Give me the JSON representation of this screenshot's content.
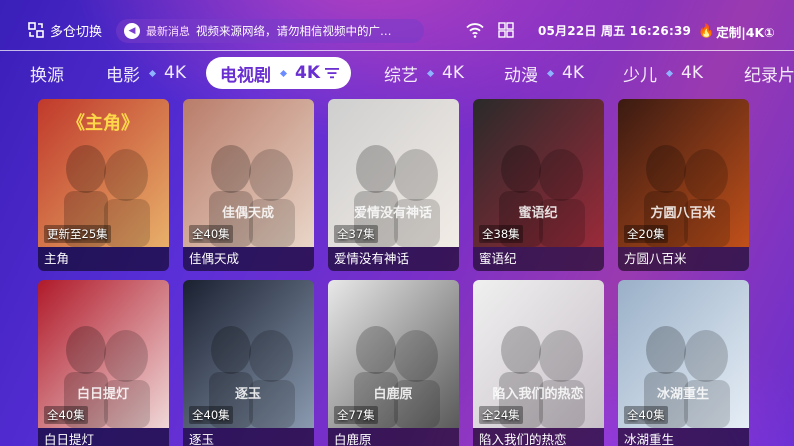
{
  "header": {
    "warehouse_switch": "多仓切换",
    "news_tag": "最新消息",
    "news_text": "视频来源网络，请勿相信视频中的广…",
    "datetime": "05月22日 周五 16:26:39",
    "custom_label": "定制|4K①"
  },
  "tabs": [
    {
      "label": "换源"
    },
    {
      "label": "电影",
      "badge": "4K"
    },
    {
      "label": "电视剧",
      "badge": "4K",
      "active": true
    },
    {
      "label": "综艺",
      "badge": "4K"
    },
    {
      "label": "动漫",
      "badge": "4K"
    },
    {
      "label": "少儿",
      "badge": "4K"
    },
    {
      "label": "纪录片"
    }
  ],
  "cards": [
    {
      "title": "主角",
      "episodes": "更新至25集",
      "poster_text": "《主角》",
      "tone": [
        "#c0392b",
        "#e8b06a"
      ]
    },
    {
      "title": "佳偶天成",
      "episodes": "全40集",
      "poster_text": "佳偶天成",
      "tone": [
        "#b97c6a",
        "#e9d6c8"
      ]
    },
    {
      "title": "爱情没有神话",
      "episodes": "全37集",
      "poster_text": "爱情没有神话",
      "tone": [
        "#cfcfcf",
        "#f2ece6"
      ]
    },
    {
      "title": "蜜语纪",
      "episodes": "全38集",
      "poster_text": "蜜语纪",
      "tone": [
        "#2a2a2a",
        "#9a2a3a"
      ]
    },
    {
      "title": "方圆八百米",
      "episodes": "全20集",
      "poster_text": "方圆八百米",
      "tone": [
        "#3a1a12",
        "#c0501a"
      ]
    },
    {
      "title": "白日提灯",
      "episodes": "全40集",
      "poster_text": "白日提灯",
      "tone": [
        "#b01a2a",
        "#f0d8d8"
      ]
    },
    {
      "title": "逐玉",
      "episodes": "全40集",
      "poster_text": "逐玉",
      "tone": [
        "#1a2030",
        "#8a9ab0"
      ]
    },
    {
      "title": "白鹿原",
      "episodes": "全77集",
      "poster_text": "白鹿原",
      "tone": [
        "#e8e8e8",
        "#5a5a5a"
      ]
    },
    {
      "title": "陷入我们的热恋",
      "episodes": "全24集",
      "poster_text": "陷入我们的热恋",
      "tone": [
        "#f0f0f0",
        "#c8c0c8"
      ]
    },
    {
      "title": "冰湖重生",
      "episodes": "全40集",
      "poster_text": "冰湖重生",
      "tone": [
        "#9ab0c8",
        "#e6eef6"
      ]
    }
  ]
}
